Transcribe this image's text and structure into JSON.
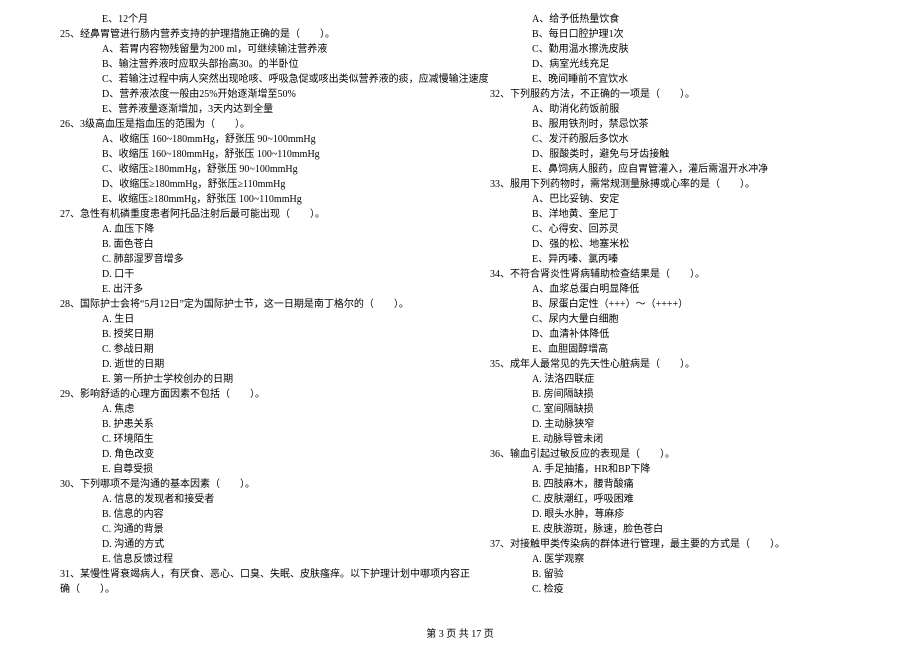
{
  "footer": "第 3 页 共 17 页",
  "left": [
    {
      "cls": "opt",
      "t": "E、12个月"
    },
    {
      "cls": "qline",
      "t": "25、经鼻胃管进行肠内营养支持的护理措施正确的是（　　）。"
    },
    {
      "cls": "opt",
      "t": "A、若胃内容物残留量为200 ml，可继续输注营养液"
    },
    {
      "cls": "opt",
      "t": "B、输注营养液时应取头部抬高30。的半卧位"
    },
    {
      "cls": "opt",
      "t": "C、若输注过程中病人突然出现呛咳、呼吸急促或咳出类似营养液的痰，应减慢输注速度"
    },
    {
      "cls": "opt",
      "t": "D、营养液浓度一般由25%开始逐渐增至50%"
    },
    {
      "cls": "opt",
      "t": "E、营养液量逐渐增加，3天内达到全量"
    },
    {
      "cls": "qline",
      "t": "26、3级高血压是指血压的范围为（　　）。"
    },
    {
      "cls": "opt",
      "t": "A、收缩压 160~180mmHg，舒张压 90~100mmHg"
    },
    {
      "cls": "opt",
      "t": "B、收缩压 160~180mmHg，舒张压 100~110mmHg"
    },
    {
      "cls": "opt",
      "t": "C、收缩压≥180mmHg，舒张压 90~100mmHg"
    },
    {
      "cls": "opt",
      "t": "D、收缩压≥180mmHg，舒张压≥110mmHg"
    },
    {
      "cls": "opt",
      "t": "E、收缩压≥180mmHg，舒张压 100~110mmHg"
    },
    {
      "cls": "qline",
      "t": "27、急性有机磷重度患者阿托品注射后最可能出现（　　）。"
    },
    {
      "cls": "opt",
      "t": "A. 血压下降"
    },
    {
      "cls": "opt",
      "t": "B. 面色苍白"
    },
    {
      "cls": "opt",
      "t": "C. 肺部湿罗音增多"
    },
    {
      "cls": "opt",
      "t": "D. 口干"
    },
    {
      "cls": "opt",
      "t": "E. 出汗多"
    },
    {
      "cls": "qline",
      "t": "28、国际护士会将“5月12日”定为国际护士节，这一日期是南丁格尔的（　　）。"
    },
    {
      "cls": "opt",
      "t": "A. 生日"
    },
    {
      "cls": "opt",
      "t": "B. 授奖日期"
    },
    {
      "cls": "opt",
      "t": "C. 参战日期"
    },
    {
      "cls": "opt",
      "t": "D. 逝世的日期"
    },
    {
      "cls": "opt",
      "t": "E. 第一所护士学校创办的日期"
    },
    {
      "cls": "qline",
      "t": "29、影响舒适的心理方面因素不包括（　　）。"
    },
    {
      "cls": "opt",
      "t": "A. 焦虑"
    },
    {
      "cls": "opt",
      "t": "B. 护患关系"
    },
    {
      "cls": "opt",
      "t": "C. 环境陌生"
    },
    {
      "cls": "opt",
      "t": "D. 角色改变"
    },
    {
      "cls": "opt",
      "t": "E. 自尊受损"
    },
    {
      "cls": "qline",
      "t": "30、下列哪项不是沟通的基本因素（　　）。"
    },
    {
      "cls": "opt",
      "t": "A. 信息的发现者和接受者"
    },
    {
      "cls": "opt",
      "t": "B. 信息的内容"
    },
    {
      "cls": "opt",
      "t": "C. 沟通的背景"
    },
    {
      "cls": "opt",
      "t": "D. 沟通的方式"
    },
    {
      "cls": "opt",
      "t": "E. 信息反馈过程"
    },
    {
      "cls": "qline",
      "t": "31、某慢性肾衰竭病人，有厌食、恶心、口臭、失眠、皮肤瘙痒。以下护理计划中哪项内容正"
    },
    {
      "cls": "qline",
      "t": "确（　　）。"
    }
  ],
  "right": [
    {
      "cls": "opt",
      "t": "A、给予低热量饮食"
    },
    {
      "cls": "opt",
      "t": "B、每日口腔护理1次"
    },
    {
      "cls": "opt",
      "t": "C、勤用温水擦洗皮肤"
    },
    {
      "cls": "opt",
      "t": "D、病室光线充足"
    },
    {
      "cls": "opt",
      "t": "E、晚间睡前不宜饮水"
    },
    {
      "cls": "qline",
      "t": "32、下列服药方法，不正确的一项是（　　）。"
    },
    {
      "cls": "opt",
      "t": "A、助消化药饭前服"
    },
    {
      "cls": "opt",
      "t": "B、服用铁剂时，禁忌饮茶"
    },
    {
      "cls": "opt",
      "t": "C、发汗药服后多饮水"
    },
    {
      "cls": "opt",
      "t": "D、服酸类时，避免与牙齿接触"
    },
    {
      "cls": "opt",
      "t": "E、鼻饲病人服药，应自胃管灌入，灌后需温开水冲净"
    },
    {
      "cls": "qline",
      "t": "33、服用下列药物时，需常规测量脉搏或心率的是（　　）。"
    },
    {
      "cls": "opt",
      "t": "A、巴比妥钠、安定"
    },
    {
      "cls": "opt",
      "t": "B、洋地黄、奎尼丁"
    },
    {
      "cls": "opt",
      "t": "C、心得安、回苏灵"
    },
    {
      "cls": "opt",
      "t": "D、强的松、地塞米松"
    },
    {
      "cls": "opt",
      "t": "E、异丙嗪、氯丙嗪"
    },
    {
      "cls": "qline",
      "t": "34、不符合肾炎性肾病辅助检查结果是（　　）。"
    },
    {
      "cls": "opt",
      "t": "A、血浆总蛋白明显降低"
    },
    {
      "cls": "opt",
      "t": "B、尿蛋白定性（+++）～（++++）"
    },
    {
      "cls": "opt",
      "t": "C、尿内大量白细胞"
    },
    {
      "cls": "opt",
      "t": "D、血清补体降低"
    },
    {
      "cls": "opt",
      "t": "E、血胆固醇增高"
    },
    {
      "cls": "qline",
      "t": "35、成年人最常见的先天性心脏病是（　　）。"
    },
    {
      "cls": "opt",
      "t": "A. 法洛四联症"
    },
    {
      "cls": "opt",
      "t": "B. 房间隔缺损"
    },
    {
      "cls": "opt",
      "t": "C. 室间隔缺损"
    },
    {
      "cls": "opt",
      "t": "D. 主动脉狭窄"
    },
    {
      "cls": "opt",
      "t": "E. 动脉导管未闭"
    },
    {
      "cls": "qline",
      "t": "36、输血引起过敏反应的表现是（　　）。"
    },
    {
      "cls": "opt",
      "t": "A. 手足抽搐，HR和BP下降"
    },
    {
      "cls": "opt",
      "t": "B. 四肢麻木，腰背酸痛"
    },
    {
      "cls": "opt",
      "t": "C. 皮肤潮红，呼吸困难"
    },
    {
      "cls": "opt",
      "t": "D. 眼头水肿，荨麻疹"
    },
    {
      "cls": "opt",
      "t": "E. 皮肤游斑，脉速，脸色苍白"
    },
    {
      "cls": "qline",
      "t": "37、对接触甲类传染病的群体进行管理，最主要的方式是（　　）。"
    },
    {
      "cls": "opt",
      "t": "A. 医学观察"
    },
    {
      "cls": "opt",
      "t": "B. 留验"
    },
    {
      "cls": "opt",
      "t": "C. 检疫"
    }
  ]
}
